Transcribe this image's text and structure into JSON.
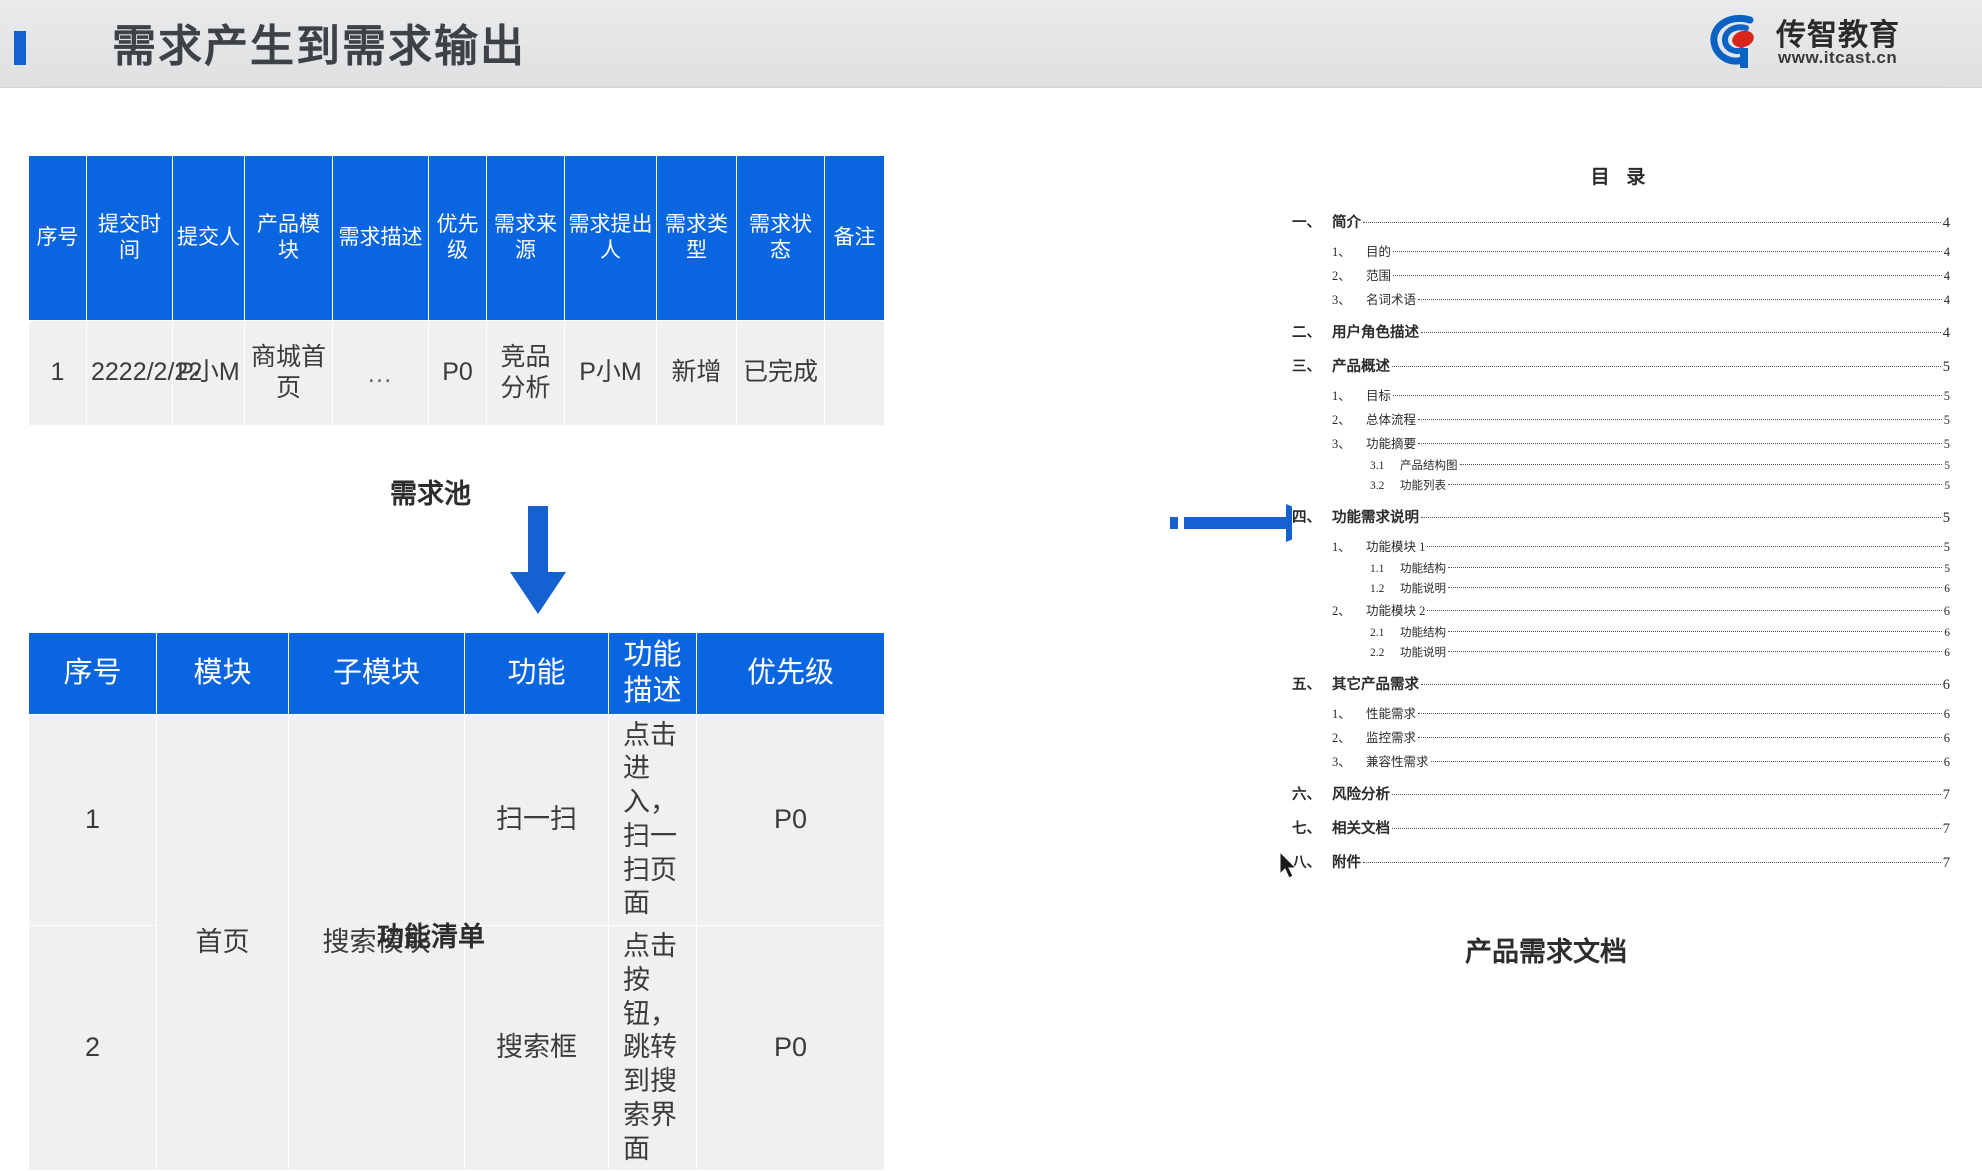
{
  "header": {
    "title": "需求产生到需求输出",
    "logo_name": "传智教育",
    "logo_url": "www.itcast.cn",
    "accent_color": "#1461d2",
    "logo_blue": "#0a63c4",
    "logo_red": "#d8261c"
  },
  "pool_table": {
    "caption": "需求池",
    "header_bg": "#0a66e0",
    "columns": [
      "序号",
      "提交时间",
      "提交人",
      "产品模块",
      "需求描述",
      "优先级",
      "需求来源",
      "需求提出人",
      "需求类型",
      "需求状态",
      "备注"
    ],
    "rows": [
      {
        "序号": "1",
        "提交时间": "2222/2/22",
        "提交人": "P小M",
        "产品模块": "商城首页",
        "需求描述": "…",
        "优先级": "P0",
        "需求来源": "竞品分析",
        "需求提出人": "P小M",
        "需求类型": "新增",
        "需求状态": "已完成",
        "备注": ""
      }
    ]
  },
  "feature_table": {
    "caption": "功能清单",
    "columns": [
      "序号",
      "模块",
      "子模块",
      "功能",
      "功能描述",
      "优先级"
    ],
    "rows": [
      {
        "序号": "1",
        "模块": "首页",
        "子模块": "搜索模块",
        "功能": "扫一扫",
        "功能描述": "点击进入，扫一扫页面",
        "优先级": "P0"
      },
      {
        "序号": "2",
        "功能": "搜索框",
        "功能描述": "点击按钮，跳转到搜索界面",
        "优先级": "P0"
      }
    ]
  },
  "prd": {
    "caption": "产品需求文档",
    "toc_title": "目 录",
    "entries": [
      {
        "level": 1,
        "num": "一、",
        "text": "简介",
        "page": "4"
      },
      {
        "level": 2,
        "num": "1、",
        "text": "目的",
        "page": "4"
      },
      {
        "level": 2,
        "num": "2、",
        "text": "范围",
        "page": "4"
      },
      {
        "level": 2,
        "num": "3、",
        "text": "名词术语",
        "page": "4"
      },
      {
        "level": 1,
        "num": "二、",
        "text": "用户角色描述",
        "page": "4"
      },
      {
        "level": 1,
        "num": "三、",
        "text": "产品概述",
        "page": "5"
      },
      {
        "level": 2,
        "num": "1、",
        "text": "目标",
        "page": "5"
      },
      {
        "level": 2,
        "num": "2、",
        "text": "总体流程",
        "page": "5"
      },
      {
        "level": 2,
        "num": "3、",
        "text": "功能摘要",
        "page": "5"
      },
      {
        "level": 3,
        "num": "3.1",
        "text": "产品结构图",
        "page": "5"
      },
      {
        "level": 3,
        "num": "3.2",
        "text": "功能列表",
        "page": "5"
      },
      {
        "level": 1,
        "num": "四、",
        "text": "功能需求说明",
        "page": "5"
      },
      {
        "level": 2,
        "num": "1、",
        "text": "功能模块 1",
        "page": "5"
      },
      {
        "level": 3,
        "num": "1.1",
        "text": "功能结构",
        "page": "5"
      },
      {
        "level": 3,
        "num": "1.2",
        "text": "功能说明",
        "page": "6"
      },
      {
        "level": 2,
        "num": "2、",
        "text": "功能模块 2",
        "page": "6"
      },
      {
        "level": 3,
        "num": "2.1",
        "text": "功能结构",
        "page": "6"
      },
      {
        "level": 3,
        "num": "2.2",
        "text": "功能说明",
        "page": "6"
      },
      {
        "level": 1,
        "num": "五、",
        "text": "其它产品需求",
        "page": "6"
      },
      {
        "level": 2,
        "num": "1、",
        "text": "性能需求",
        "page": "6"
      },
      {
        "level": 2,
        "num": "2、",
        "text": "监控需求",
        "page": "6"
      },
      {
        "level": 2,
        "num": "3、",
        "text": "兼容性需求",
        "page": "6"
      },
      {
        "level": 1,
        "num": "六、",
        "text": "风险分析",
        "page": "7"
      },
      {
        "level": 1,
        "num": "七、",
        "text": "相关文档",
        "page": "7"
      },
      {
        "level": 1,
        "num": "八、",
        "text": "附件",
        "page": "7"
      }
    ]
  },
  "arrows": {
    "down_color": "#1461d2",
    "right_color": "#1461d2"
  }
}
